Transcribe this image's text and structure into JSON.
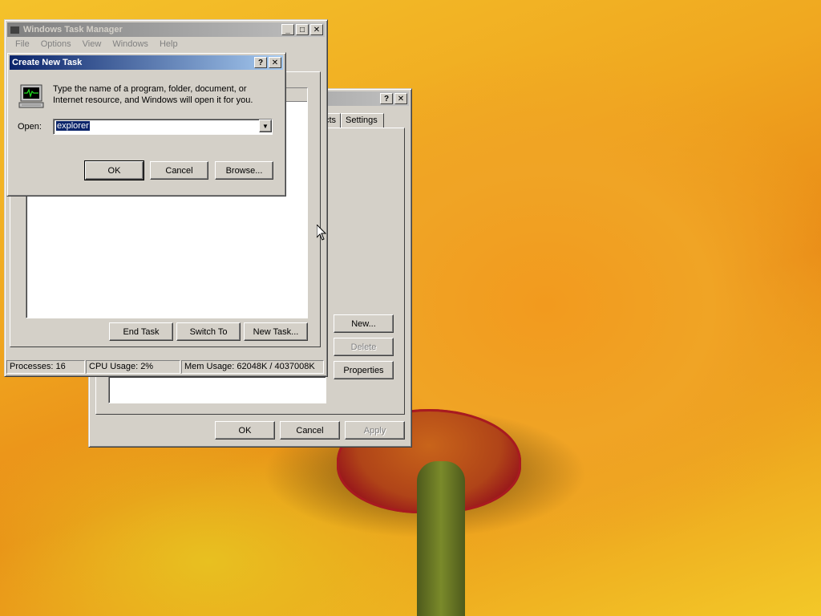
{
  "task_manager": {
    "title": "Windows Task Manager",
    "menu": [
      "File",
      "Options",
      "View",
      "Windows",
      "Help"
    ],
    "buttons": {
      "end_task": "End Task",
      "switch_to": "Switch To",
      "new_task": "New Task..."
    },
    "status": {
      "processes": "Processes: 16",
      "cpu": "CPU Usage: 2%",
      "mem": "Mem Usage: 62048K / 4037008K"
    }
  },
  "back_dialog": {
    "title_btns": {
      "help": "?",
      "close": "✕"
    },
    "tabs": [
      "cts",
      "Settings"
    ],
    "side_buttons": {
      "new": "New...",
      "delete": "Delete",
      "properties": "Properties"
    },
    "bottom_buttons": {
      "ok": "OK",
      "cancel": "Cancel",
      "apply": "Apply"
    }
  },
  "create_task": {
    "title": "Create New Task",
    "description": "Type the name of a program, folder, document, or Internet resource, and Windows will open it for you.",
    "open_label": "Open:",
    "open_value": "explorer",
    "buttons": {
      "ok": "OK",
      "cancel": "Cancel",
      "browse": "Browse..."
    }
  },
  "colors": {
    "titlebar_active": "#0a246a",
    "face": "#d4d0c8",
    "selection": "#0a246a"
  }
}
